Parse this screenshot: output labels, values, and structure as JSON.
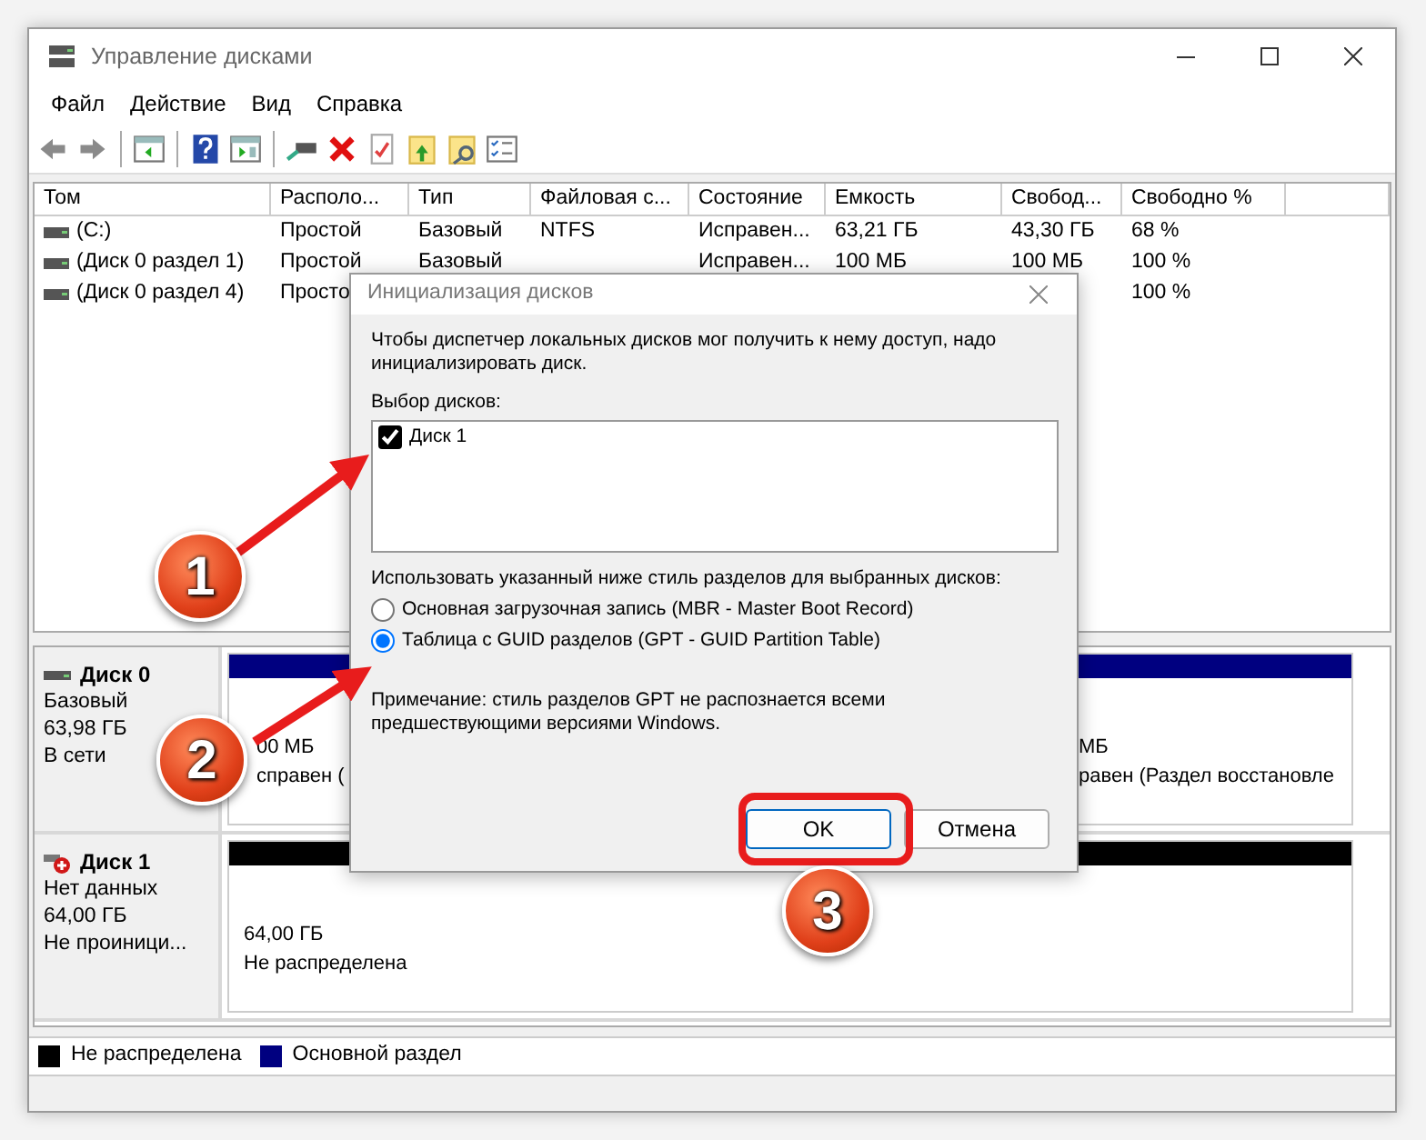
{
  "window": {
    "title": "Управление дисками"
  },
  "menu": [
    "Файл",
    "Действие",
    "Вид",
    "Справка"
  ],
  "volumes": {
    "columns": [
      "Том",
      "Располо...",
      "Тип",
      "Файловая с...",
      "Состояние",
      "Емкость",
      "Свобод...",
      "Свободно %"
    ],
    "rows": [
      [
        "(C:)",
        "Простой",
        "Базовый",
        "NTFS",
        "Исправен...",
        "63,21 ГБ",
        "43,30 ГБ",
        "68 %"
      ],
      [
        "(Диск 0 раздел 1)",
        "Простой",
        "Базовый",
        null,
        "Исправен...",
        "100 МБ",
        "100 МБ",
        "100 %"
      ],
      [
        "(Диск 0 раздел 4)",
        "Просто",
        null,
        null,
        null,
        null,
        null,
        "100 %"
      ]
    ]
  },
  "disks": [
    {
      "name": "Диск 0",
      "error": false,
      "type": "Базовый",
      "size": "63,98 ГБ",
      "status": "В сети",
      "partitions": [
        {
          "kind": "primary",
          "size": "00 МБ",
          "status": "справен ("
        },
        {
          "kind": "primary",
          "size": "МБ",
          "status": "равен (Раздел восстановле"
        }
      ]
    },
    {
      "name": "Диск 1",
      "error": true,
      "type": "Нет данных",
      "size": "64,00 ГБ",
      "status": "Не проиници...",
      "partitions": [
        {
          "kind": "unallocated",
          "size": "64,00 ГБ",
          "status": "Не распределена"
        }
      ]
    }
  ],
  "legend": [
    {
      "label": "Не распределена",
      "color": "#000000"
    },
    {
      "label": "Основной раздел",
      "color": "#000080"
    }
  ],
  "dialog": {
    "title": "Инициализация дисков",
    "message": "Чтобы диспетчер локальных дисков мог получить к нему доступ, надо инициализировать диск.",
    "select_label": "Выбор дисков:",
    "disks": [
      {
        "label": "Диск 1",
        "checked": true
      }
    ],
    "style_label": "Использовать указанный ниже стиль разделов для выбранных дисков:",
    "styles": [
      {
        "label": "Основная загрузочная запись (MBR - Master Boot Record)",
        "selected": false
      },
      {
        "label": "Таблица с GUID разделов (GPT - GUID Partition Table)",
        "selected": true
      }
    ],
    "note": "Примечание: стиль разделов GPT не распознается всеми предшествующими версиями Windows.",
    "buttons": [
      {
        "label": "OK",
        "highlighted": true
      },
      {
        "label": "Отмена",
        "highlighted": false
      }
    ]
  },
  "callouts": [
    "1",
    "2",
    "3"
  ]
}
